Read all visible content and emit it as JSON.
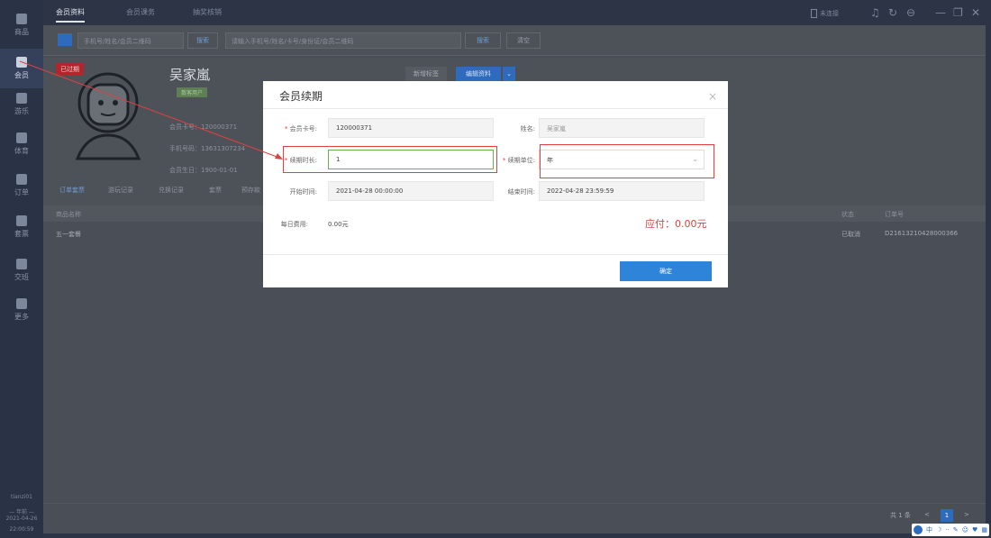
{
  "sidebar": {
    "items": [
      {
        "label": "商品"
      },
      {
        "label": "会员"
      },
      {
        "label": "游乐"
      },
      {
        "label": "体育"
      },
      {
        "label": "订单"
      },
      {
        "label": "套票"
      },
      {
        "label": "交班"
      },
      {
        "label": "更多"
      }
    ],
    "user": "tianzi01",
    "date_label": "— 年前 —",
    "date": "2021-04-26",
    "time": "22:00:59"
  },
  "topbar": {
    "tabs": [
      "会员资料",
      "会员课务",
      "抽奖核销"
    ],
    "right_label": "未连接"
  },
  "search": {
    "placeholder1": "手机号/姓名/会员二维码",
    "mini_btn": "搜索",
    "placeholder2": "请输入手机号/姓名/卡号/身份证/会员二维码",
    "search_btn": "搜索",
    "clear_btn": "清空"
  },
  "profile": {
    "expired_badge": "已过期",
    "name": "吴家嵐",
    "member_tag": "散客用户",
    "card_no": "会员卡号：120000371",
    "phone": "手机号码：13631307234",
    "birthday": "会员生日：1900-01-01",
    "add_tag_btn": "新增标签",
    "edit_btn": "编辑资料"
  },
  "subtabs": [
    "订单套票",
    "游玩记录",
    "兑换记录",
    "套票",
    "预存款"
  ],
  "table": {
    "headers": {
      "product": "商品名称",
      "status": "状态",
      "order_no": "订单号"
    },
    "rows": [
      {
        "product": "五一套餐",
        "status": "已取消",
        "order_no": "D21613210428000366"
      }
    ]
  },
  "pagination": {
    "total": "共 1 条",
    "current": "1",
    "prev": "<",
    "next": ">"
  },
  "modal": {
    "title": "会员续期",
    "close": "×",
    "card_label": "会员卡号:",
    "card_value": "120000371",
    "name_label": "姓名:",
    "name_value": "吴家嵐",
    "duration_label": "续期时长:",
    "duration_value": "1",
    "unit_label": "续期单位:",
    "unit_value": "年",
    "start_label": "开始时间:",
    "start_value": "2021-04-28 00:00:00",
    "end_label": "结束时间:",
    "end_value": "2022-04-28 23:59:59",
    "fee_label": "每日费用:",
    "fee_value": "0.00元",
    "pay_text": "应付：0.00元",
    "confirm": "确定"
  },
  "tray": {
    "ime": "中"
  },
  "colors": {
    "accent": "#2e84d8",
    "danger": "#e04040",
    "sidebar_bg": "#2a3346"
  }
}
